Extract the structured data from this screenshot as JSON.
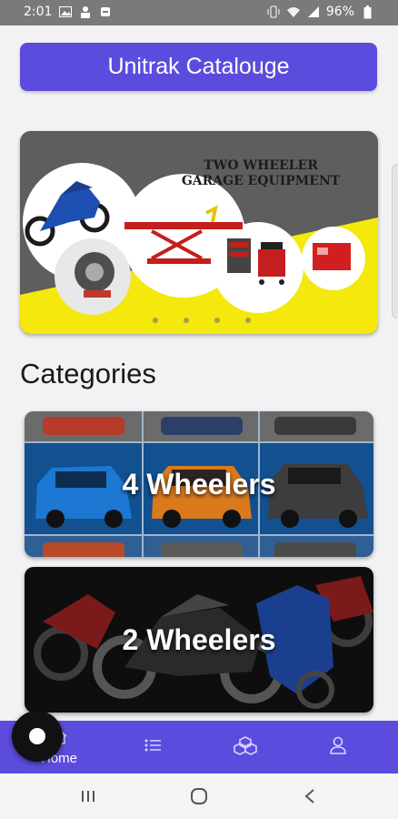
{
  "status_bar": {
    "time": "2:01",
    "battery": "96%",
    "left_icons": [
      "gallery-icon",
      "person-icon",
      "sync-icon"
    ],
    "right_icons": [
      "vibrate-icon",
      "wifi-icon",
      "signal-icon",
      "battery-icon"
    ]
  },
  "header": {
    "title": "Unitrak Catalouge"
  },
  "banner": {
    "title_line1": "TWO WHEELER",
    "title_line2": "GARAGE EQUIPMENT",
    "slide_count": 4,
    "active_slide": 0
  },
  "categories": {
    "heading": "Categories",
    "items": [
      {
        "label": "4 Wheelers"
      },
      {
        "label": "2 Wheelers"
      }
    ]
  },
  "bottom_nav": {
    "items": [
      {
        "icon": "home-icon",
        "label": "Home"
      },
      {
        "icon": "list-icon",
        "label": ""
      },
      {
        "icon": "boxes-icon",
        "label": ""
      },
      {
        "icon": "profile-icon",
        "label": ""
      }
    ]
  },
  "colors": {
    "primary": "#5b4cde",
    "banner_yellow": "#f4e80c",
    "banner_gray": "#5e5e5e"
  }
}
